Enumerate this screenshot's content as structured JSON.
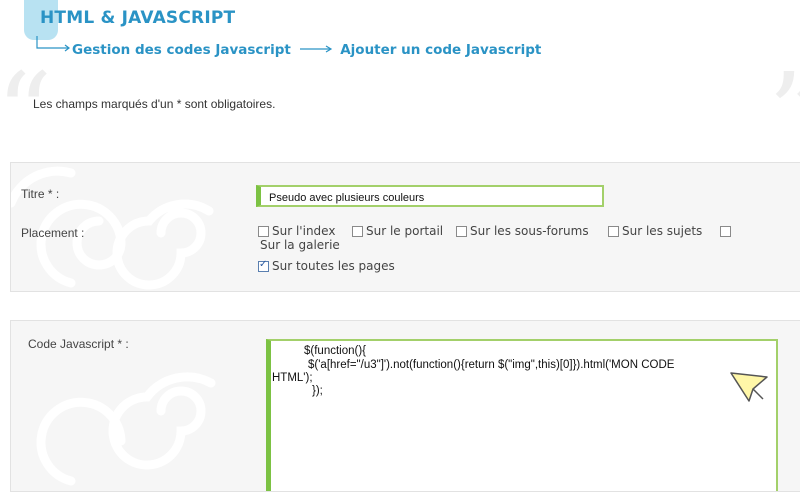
{
  "header": {
    "title": "HTML & JAVASCRIPT"
  },
  "breadcrumb": {
    "items": [
      "Gestion des codes Javascript",
      "Ajouter un code Javascript"
    ]
  },
  "notice": "Les champs marqués d'un * sont obligatoires.",
  "form": {
    "titre_label": "Titre * :",
    "titre_value": "Pseudo avec plusieurs couleurs",
    "placement_label": "Placement :",
    "placement_options": [
      {
        "label": "Sur l'index",
        "checked": false
      },
      {
        "label": "Sur le portail",
        "checked": false
      },
      {
        "label": "Sur les sous-forums",
        "checked": false
      },
      {
        "label": "Sur les sujets",
        "checked": false
      },
      {
        "label": "Sur la galerie",
        "checked": false
      },
      {
        "label": "Sur toutes les pages",
        "checked": true
      }
    ],
    "code_label": "Code Javascript * :",
    "code_lines": [
      "$(function(){",
      "$('a[href=\"/u3\"]').not(function(){return $(\"img\",this)[0]}).html('MON CODE",
      "HTML');",
      "});"
    ]
  },
  "colors": {
    "accent": "#2a93c5",
    "input_border": "#7cc243",
    "panel_bg": "#f6f6f6"
  },
  "icons": [
    "arrow-right-icon",
    "quote-open-icon",
    "quote-close-icon",
    "checkbox-icon",
    "swirl-decoration",
    "pointer-cursor-icon"
  ]
}
